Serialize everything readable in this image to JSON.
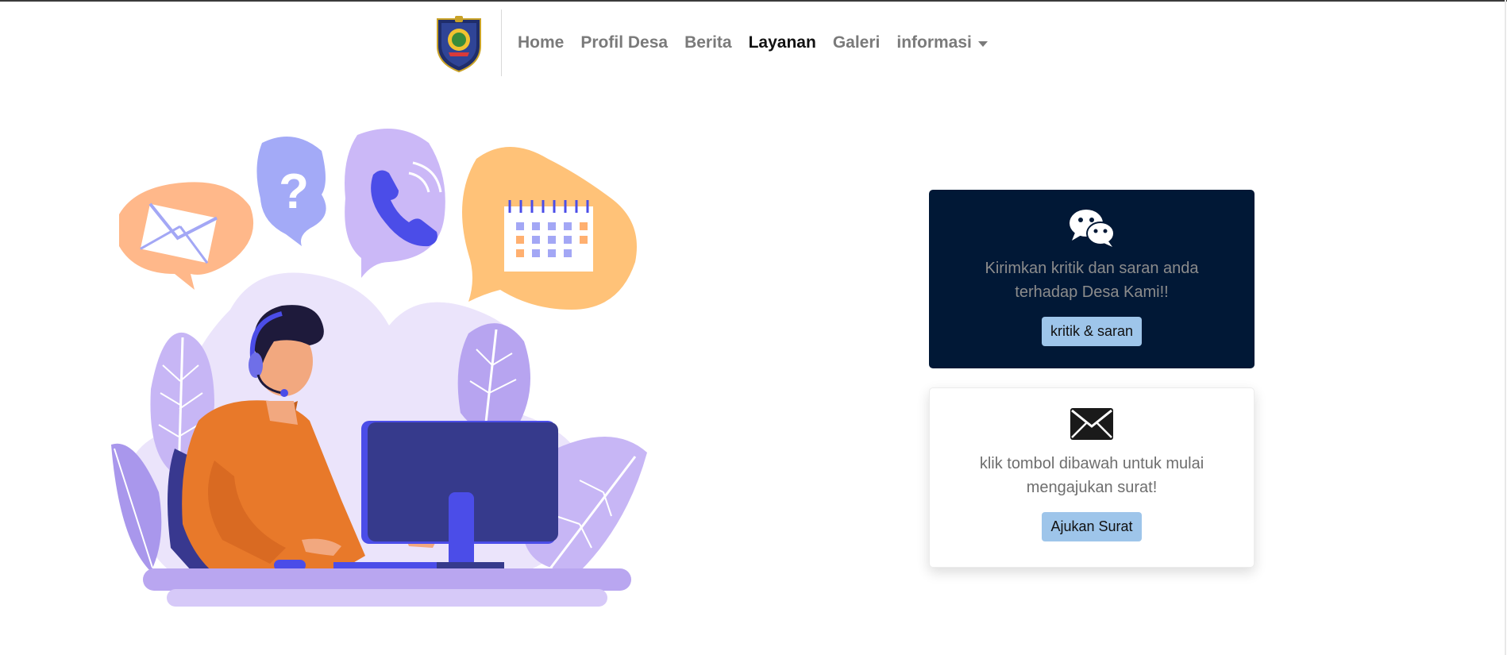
{
  "nav": {
    "logo_alt": "Logo Desa",
    "items": [
      {
        "label": "Home",
        "active": false
      },
      {
        "label": "Profil Desa",
        "active": false
      },
      {
        "label": "Berita",
        "active": false
      },
      {
        "label": "Layanan",
        "active": true
      },
      {
        "label": "Galeri",
        "active": false
      }
    ],
    "dropdown_label": "informasi",
    "dropdown_icon": "caret-down-icon"
  },
  "illustration": {
    "icons": [
      "envelope-icon",
      "question-icon",
      "phone-icon",
      "calendar-icon"
    ],
    "description_name": "customer-service-illustration"
  },
  "cards": {
    "feedback": {
      "icon": "wechat-icon",
      "text_line1": "Kirimkan kritik dan saran anda",
      "text_line2": "terhadap Desa Kami!!",
      "button_label": "kritik & saran"
    },
    "letter": {
      "icon": "envelope-icon",
      "text_line1": "klik tombol dibawah untuk mulai",
      "text_line2": "mengajukan surat!",
      "button_label": "Ajukan Surat"
    }
  },
  "colors": {
    "dark_card": "#011836",
    "button": "#9ec5ea",
    "active_nav": "#111111",
    "nav": "#7a7a7a"
  }
}
